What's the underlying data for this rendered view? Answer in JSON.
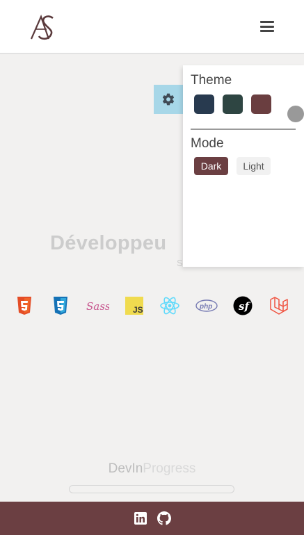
{
  "header": {
    "logo_text": "AS",
    "menu_icon": "hamburger-icon"
  },
  "settings": {
    "gear_icon": "gear-icon",
    "theme_title": "Theme",
    "theme_colors": [
      "#283a4f",
      "#2e4542",
      "#6a3e40"
    ],
    "mode_title": "Mode",
    "mode_dark_label": "Dark",
    "mode_light_label": "Light",
    "mode_selected": "Dark",
    "accent": "#6b3f42"
  },
  "hero": {
    "title": "Développeu",
    "subtitle": "S"
  },
  "tech_icons": [
    "html5-icon",
    "css3-icon",
    "sass-icon",
    "javascript-icon",
    "react-icon",
    "php-icon",
    "symfony-icon",
    "laravel-icon"
  ],
  "brand": {
    "part1": "DevIn",
    "part2": "Progress",
    "progress": 0
  },
  "footer": {
    "links": [
      "linkedin-icon",
      "github-icon"
    ],
    "background": "#6b3f42"
  }
}
